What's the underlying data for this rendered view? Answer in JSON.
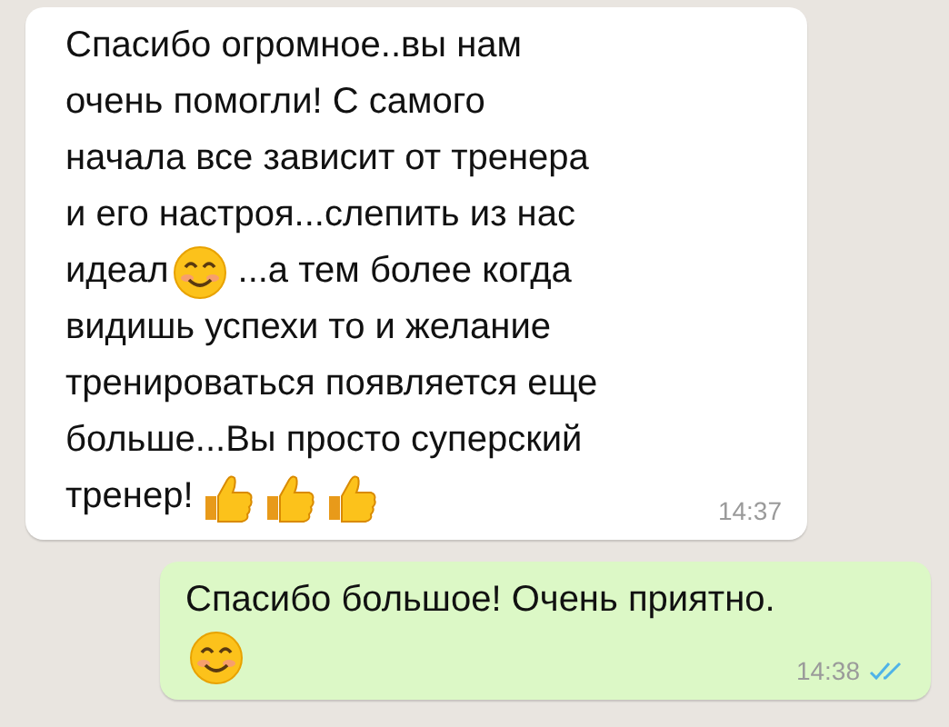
{
  "messages": [
    {
      "kind": "incoming",
      "lines": [
        [
          {
            "kind": "text",
            "text": "Спасибо огромное..вы нам"
          }
        ],
        [
          {
            "kind": "text",
            "text": "очень помогли! С самого"
          }
        ],
        [
          {
            "kind": "text",
            "text": "начала все зависит от тренера"
          }
        ],
        [
          {
            "kind": "text",
            "text": "и его настроя...слепить из нас"
          }
        ],
        [
          {
            "kind": "text",
            "text": "идеал"
          },
          {
            "kind": "smile"
          },
          {
            "kind": "text",
            "text": "...а тем более когда"
          }
        ],
        [
          {
            "kind": "text",
            "text": "видишь успехи то и желание"
          }
        ],
        [
          {
            "kind": "text",
            "text": "тренироваться появляется еще"
          }
        ],
        [
          {
            "kind": "text",
            "text": "больше...Вы просто суперский"
          }
        ],
        [
          {
            "kind": "text",
            "text": "тренер!"
          },
          {
            "kind": "thumb"
          },
          {
            "kind": "thumb"
          },
          {
            "kind": "thumb"
          }
        ]
      ],
      "time": "14:37"
    },
    {
      "kind": "outgoing",
      "lines": [
        [
          {
            "kind": "text",
            "text": "Спасибо большое! Очень приятно."
          }
        ],
        [
          {
            "kind": "smile"
          }
        ]
      ],
      "time": "14:38",
      "read": true
    }
  ]
}
